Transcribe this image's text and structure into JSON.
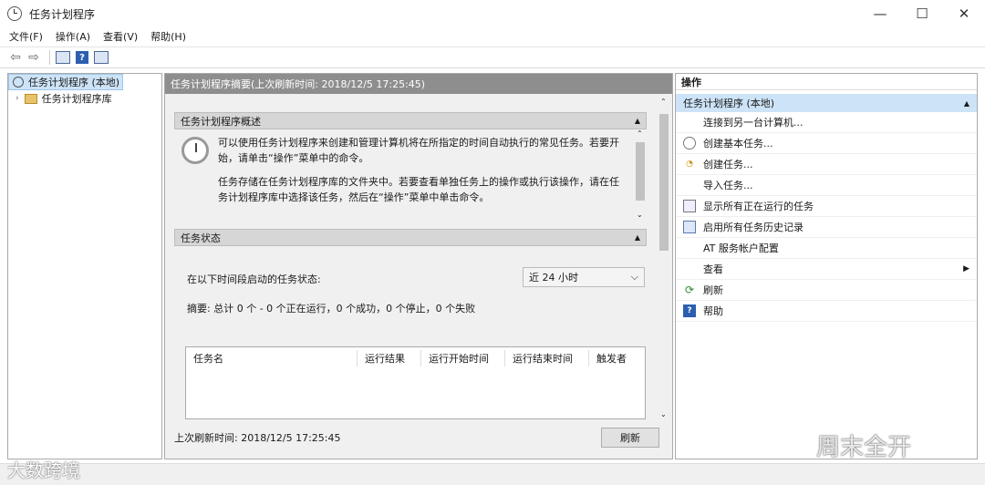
{
  "window": {
    "title": "任务计划程序",
    "minimize": "—",
    "maximize": "☐",
    "close": "✕"
  },
  "menu": [
    "文件(F)",
    "操作(A)",
    "查看(V)",
    "帮助(H)"
  ],
  "tree": {
    "root": "任务计划程序 (本地)",
    "child": "任务计划程序库"
  },
  "center": {
    "header": "任务计划程序摘要(上次刷新时间: 2018/12/5 17:25:45)",
    "overview_title": "任务计划程序概述",
    "overview_p1": "可以使用任务计划程序来创建和管理计算机将在所指定的时间自动执行的常见任务。若要开始，请单击“操作”菜单中的命令。",
    "overview_p2": "任务存储在任务计划程序库的文件夹中。若要查看单独任务上的操作或执行该操作，请在任务计划程序库中选择该任务，然后在“操作”菜单中单击命令。",
    "status_title": "任务状态",
    "status_label": "在以下时间段启动的任务状态:",
    "period": "近 24 小时",
    "summary": "摘要: 总计 0 个 - 0 个正在运行，0 个成功，0 个停止，0 个失败",
    "columns": [
      "任务名",
      "运行结果",
      "运行开始时间",
      "运行结束时间",
      "触发者"
    ],
    "last_refresh": "上次刷新时间: 2018/12/5 17:25:45",
    "refresh_button": "刷新"
  },
  "actions": {
    "header": "操作",
    "group": "任务计划程序 (本地)",
    "items": [
      "连接到另一台计算机...",
      "创建基本任务...",
      "创建任务...",
      "导入任务...",
      "显示所有正在运行的任务",
      "启用所有任务历史记录",
      "AT 服务帐户配置",
      "查看",
      "刷新",
      "帮助"
    ]
  },
  "watermarks": {
    "left": "大数跨境",
    "right": "周末全开"
  }
}
